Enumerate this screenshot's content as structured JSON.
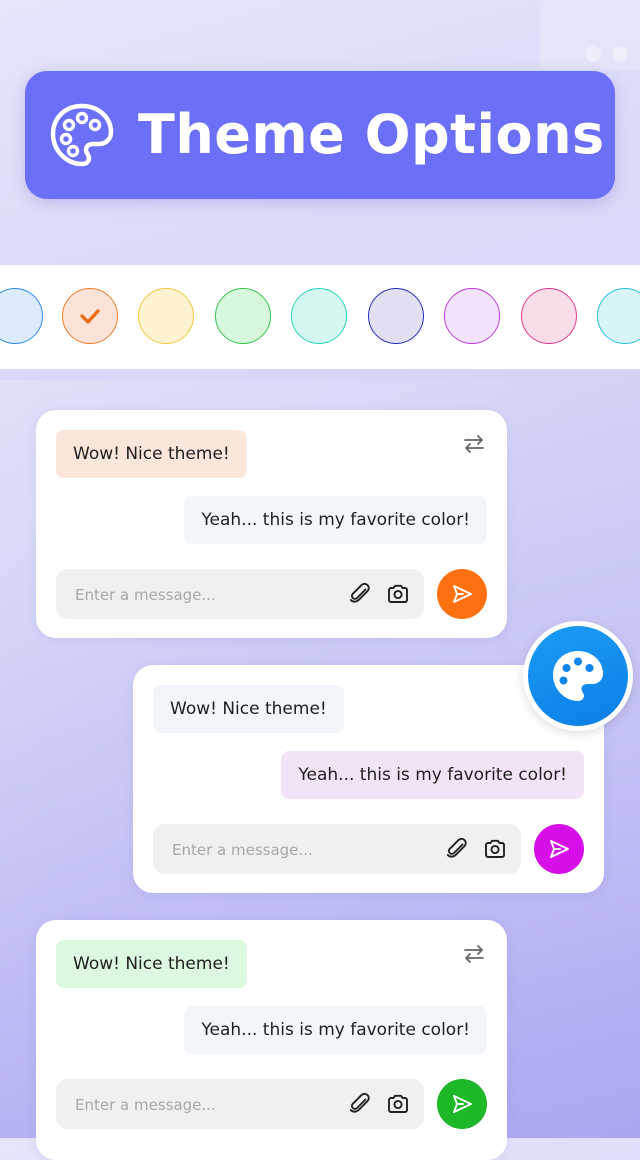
{
  "header": {
    "title": "Theme Options",
    "icon": "palette-icon"
  },
  "swatches": [
    {
      "name": "blue",
      "fill": "#dcebfb",
      "border": "#2f8ce8",
      "selected": false
    },
    {
      "name": "orange",
      "fill": "#fbe3d7",
      "border": "#f07c2e",
      "selected": true
    },
    {
      "name": "yellow",
      "fill": "#fdf3d1",
      "border": "#f5c63c",
      "selected": false
    },
    {
      "name": "green",
      "fill": "#d8f8dc",
      "border": "#37c24d",
      "selected": false
    },
    {
      "name": "teal",
      "fill": "#d4f7f1",
      "border": "#2cd3b8",
      "selected": false
    },
    {
      "name": "indigo",
      "fill": "#e0e0f1",
      "border": "#2d2bc2",
      "selected": false
    },
    {
      "name": "purple",
      "fill": "#f3e2f8",
      "border": "#c13ee0",
      "selected": false
    },
    {
      "name": "pink",
      "fill": "#f8dce8",
      "border": "#e03c8f",
      "selected": false
    },
    {
      "name": "cyan",
      "fill": "#d9f4f9",
      "border": "#2cc0dc",
      "selected": false
    }
  ],
  "cards": [
    {
      "theme": "orange",
      "received": "Wow! Nice theme!",
      "sent": "Yeah... this is my favorite color!",
      "received_color": "#fbe6da",
      "sent_color": "#f2f5f9",
      "placeholder": "Enter a message...",
      "send_color": "#ff7110",
      "show_swap": true
    },
    {
      "theme": "purple",
      "received": "Wow! Nice theme!",
      "sent": "Yeah... this is my favorite color!",
      "received_color": "#f2f5f9",
      "sent_color": "#f2e4f7",
      "placeholder": "Enter a message...",
      "send_color": "#d60fe8",
      "show_swap": false
    },
    {
      "theme": "green",
      "received": "Wow! Nice theme!",
      "sent": "Yeah... this is my favorite color!",
      "received_color": "#dcf8df",
      "sent_color": "#f2f5f9",
      "placeholder": "Enter a message...",
      "send_color": "#1db728",
      "show_swap": true
    }
  ],
  "fab": {
    "icon": "palette-icon",
    "color": "#0e86ec"
  }
}
